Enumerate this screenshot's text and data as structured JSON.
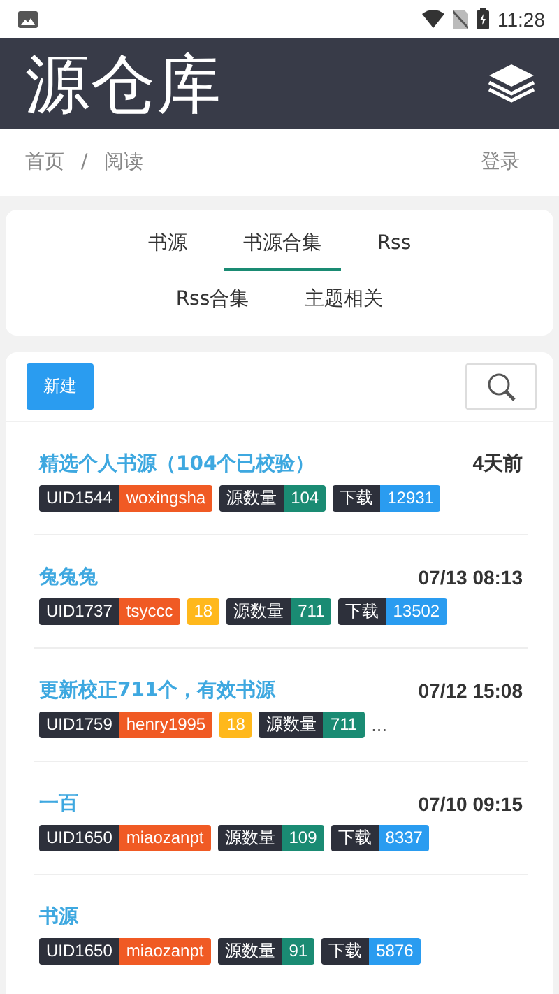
{
  "status_bar": {
    "time": "11:28"
  },
  "header": {
    "title": "源仓库"
  },
  "breadcrumb": {
    "items": [
      "首页",
      "阅读"
    ],
    "separator": "/",
    "login": "登录"
  },
  "tabs": [
    {
      "label": "书源",
      "selected": false
    },
    {
      "label": "书源合集",
      "selected": true
    },
    {
      "label": "Rss",
      "selected": false
    },
    {
      "label": "Rss合集",
      "selected": false
    },
    {
      "label": "主题相关",
      "selected": false
    }
  ],
  "new_button": "新建",
  "items": [
    {
      "title": "精选个人书源（104个已校验）",
      "time": "4天前",
      "tags": [
        {
          "kind": "uid",
          "text": "UID1544"
        },
        {
          "kind": "user",
          "text": "woxingsha"
        },
        {
          "kind": "pair",
          "label": "源数量",
          "value": "104",
          "color": "#1a8b73"
        },
        {
          "kind": "pair",
          "label": "下载",
          "value": "12931",
          "color": "#2a9cf0"
        }
      ]
    },
    {
      "title": "兔兔兔",
      "time": "07/13 08:13",
      "tags": [
        {
          "kind": "uid",
          "text": "UID1737"
        },
        {
          "kind": "user",
          "text": "tsyccc"
        },
        {
          "kind": "level",
          "text": "18"
        },
        {
          "kind": "pair",
          "label": "源数量",
          "value": "711",
          "color": "#1a8b73"
        },
        {
          "kind": "pair",
          "label": "下载",
          "value": "13502",
          "color": "#2a9cf0"
        }
      ]
    },
    {
      "title": "更新校正711个，有效书源",
      "time": "07/12 15:08",
      "tags": [
        {
          "kind": "uid",
          "text": "UID1759"
        },
        {
          "kind": "user",
          "text": "henry1995"
        },
        {
          "kind": "level",
          "text": "18"
        },
        {
          "kind": "pair",
          "label": "源数量",
          "value": "711",
          "color": "#1a8b73"
        },
        {
          "kind": "more",
          "text": "..."
        }
      ]
    },
    {
      "title": "一百",
      "time": "07/10 09:15",
      "tags": [
        {
          "kind": "uid",
          "text": "UID1650"
        },
        {
          "kind": "user",
          "text": "miaozanpt"
        },
        {
          "kind": "pair",
          "label": "源数量",
          "value": "109",
          "color": "#1a8b73"
        },
        {
          "kind": "pair",
          "label": "下载",
          "value": "8337",
          "color": "#2a9cf0"
        }
      ]
    },
    {
      "title": "书源",
      "tags": [
        {
          "kind": "uid",
          "text": "UID1650"
        },
        {
          "kind": "user",
          "text": "miaozanpt"
        },
        {
          "kind": "pair",
          "label": "源数量",
          "value": "91",
          "color": "#1a8b73"
        },
        {
          "kind": "pair",
          "label": "下载",
          "value": "5876",
          "color": "#2a9cf0"
        }
      ]
    }
  ]
}
